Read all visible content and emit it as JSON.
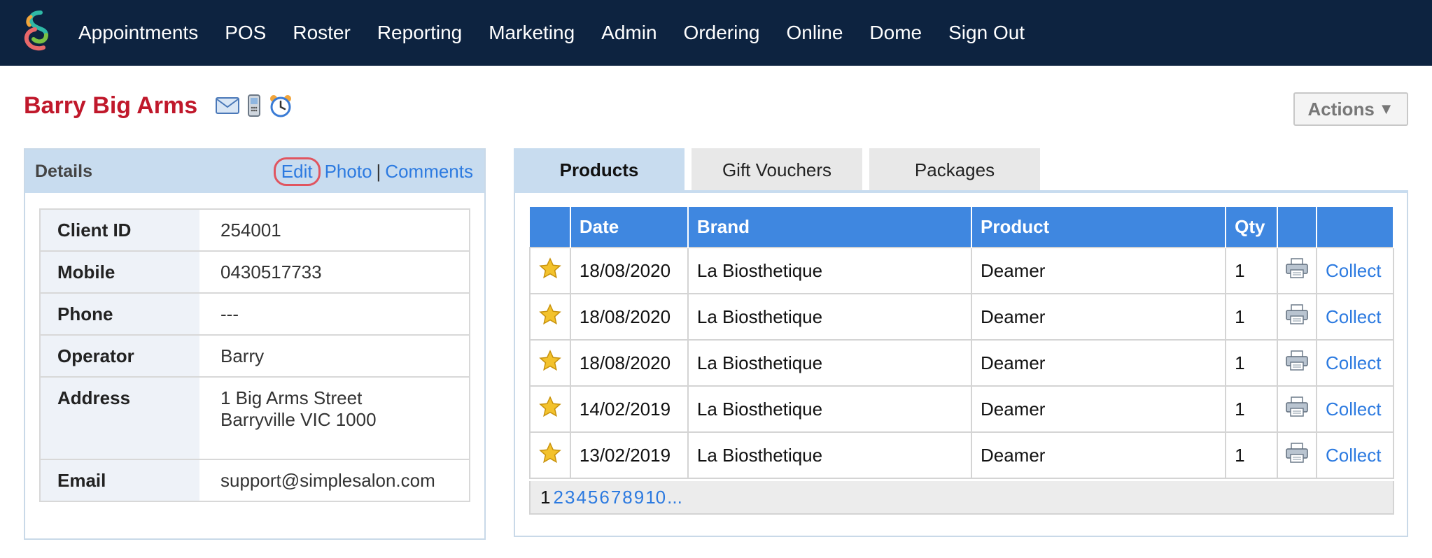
{
  "nav": {
    "items": [
      "Appointments",
      "POS",
      "Roster",
      "Reporting",
      "Marketing",
      "Admin",
      "Ordering",
      "Online",
      "Dome",
      "Sign Out"
    ]
  },
  "client": {
    "name": "Barry Big Arms"
  },
  "actions": {
    "label": "Actions",
    "arrow": "▼"
  },
  "details": {
    "title": "Details",
    "links": {
      "edit": "Edit",
      "photo": "Photo",
      "comments": "Comments",
      "separator": "|"
    },
    "rows": [
      {
        "label": "Client ID",
        "value": "254001"
      },
      {
        "label": "Mobile",
        "value": "0430517733"
      },
      {
        "label": "Phone",
        "value": "---"
      },
      {
        "label": "Operator",
        "value": "Barry"
      },
      {
        "label": "Address",
        "line1": "1 Big Arms Street",
        "line2": "Barryville VIC 1000"
      },
      {
        "label": "Email",
        "value": "support@simplesalon.com"
      }
    ]
  },
  "tabs": [
    "Products",
    "Gift Vouchers",
    "Packages"
  ],
  "products": {
    "headers": [
      "",
      "Date",
      "Brand",
      "Product",
      "Qty",
      "",
      ""
    ],
    "rows": [
      {
        "date": "18/08/2020",
        "brand": "La Biosthetique",
        "product": "Deamer",
        "qty": "1",
        "action": "Collect"
      },
      {
        "date": "18/08/2020",
        "brand": "La Biosthetique",
        "product": "Deamer",
        "qty": "1",
        "action": "Collect"
      },
      {
        "date": "18/08/2020",
        "brand": "La Biosthetique",
        "product": "Deamer",
        "qty": "1",
        "action": "Collect"
      },
      {
        "date": "14/02/2019",
        "brand": "La Biosthetique",
        "product": "Deamer",
        "qty": "1",
        "action": "Collect"
      },
      {
        "date": "13/02/2019",
        "brand": "La Biosthetique",
        "product": "Deamer",
        "qty": "1",
        "action": "Collect"
      }
    ]
  },
  "pager": {
    "current": "1",
    "pages": [
      "2",
      "3",
      "4",
      "5",
      "6",
      "7",
      "8",
      "9",
      "10",
      "..."
    ]
  },
  "colors": {
    "nav_bg": "#0d2340",
    "client_name": "#c0182b",
    "link": "#2c7ae0",
    "table_header": "#3f87e0",
    "panel_header": "#c8dcef",
    "edit_highlight": "#e05560"
  }
}
